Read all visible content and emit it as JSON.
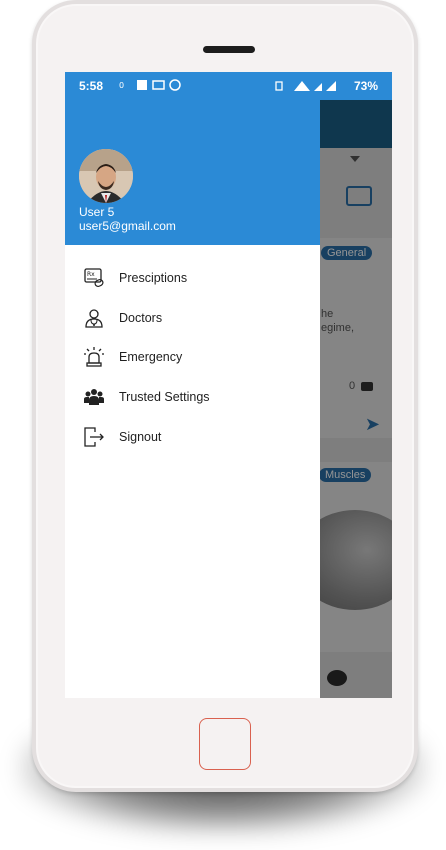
{
  "status_bar": {
    "time": "5:58",
    "battery": "73%"
  },
  "drawer": {
    "user_name": "User 5",
    "user_email": "user5@gmail.com",
    "menu": [
      {
        "label": "Presciptions",
        "icon": "prescription-icon"
      },
      {
        "label": "Doctors",
        "icon": "doctor-icon"
      },
      {
        "label": "Emergency",
        "icon": "siren-icon"
      },
      {
        "label": "Trusted Settings",
        "icon": "group-icon"
      },
      {
        "label": "Signout",
        "icon": "signout-icon"
      }
    ]
  },
  "background_app": {
    "tag1": "General",
    "tag2": "Muscles",
    "snippet1": "he",
    "snippet2": "egime,",
    "comment_count": "0"
  },
  "colors": {
    "header": "#2b8ad6",
    "toolbar": "#1a5f87",
    "home_button_outline": "#d9614f"
  }
}
